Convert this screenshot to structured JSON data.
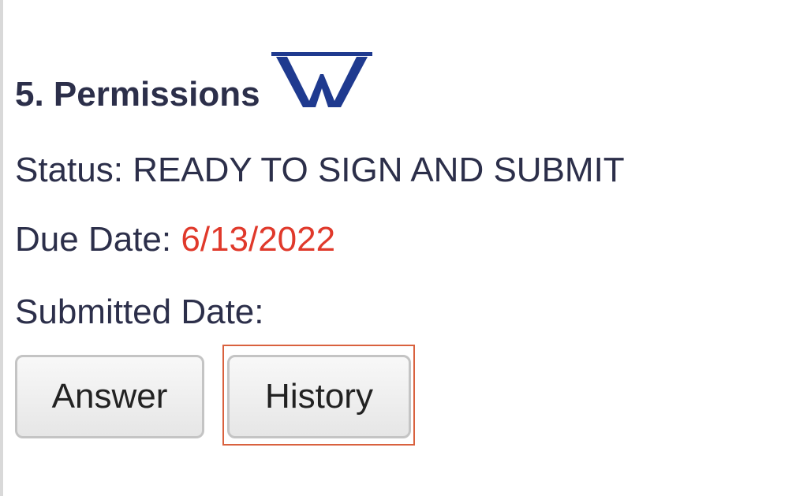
{
  "section": {
    "title": "5. Permissions",
    "logo_icon": "w-logo-icon"
  },
  "status": {
    "label": "Status: ",
    "value": "READY TO SIGN AND SUBMIT"
  },
  "due_date": {
    "label": "Due Date: ",
    "value": "6/13/2022",
    "value_color": "#e0392b"
  },
  "submitted_date": {
    "label": "Submitted Date:",
    "value": ""
  },
  "actions": {
    "answer_label": "Answer",
    "history_label": "History",
    "focused": "History",
    "focus_color": "#d9613e"
  },
  "colors": {
    "text": "#2c2f4a",
    "logo": "#1f3a8f"
  }
}
